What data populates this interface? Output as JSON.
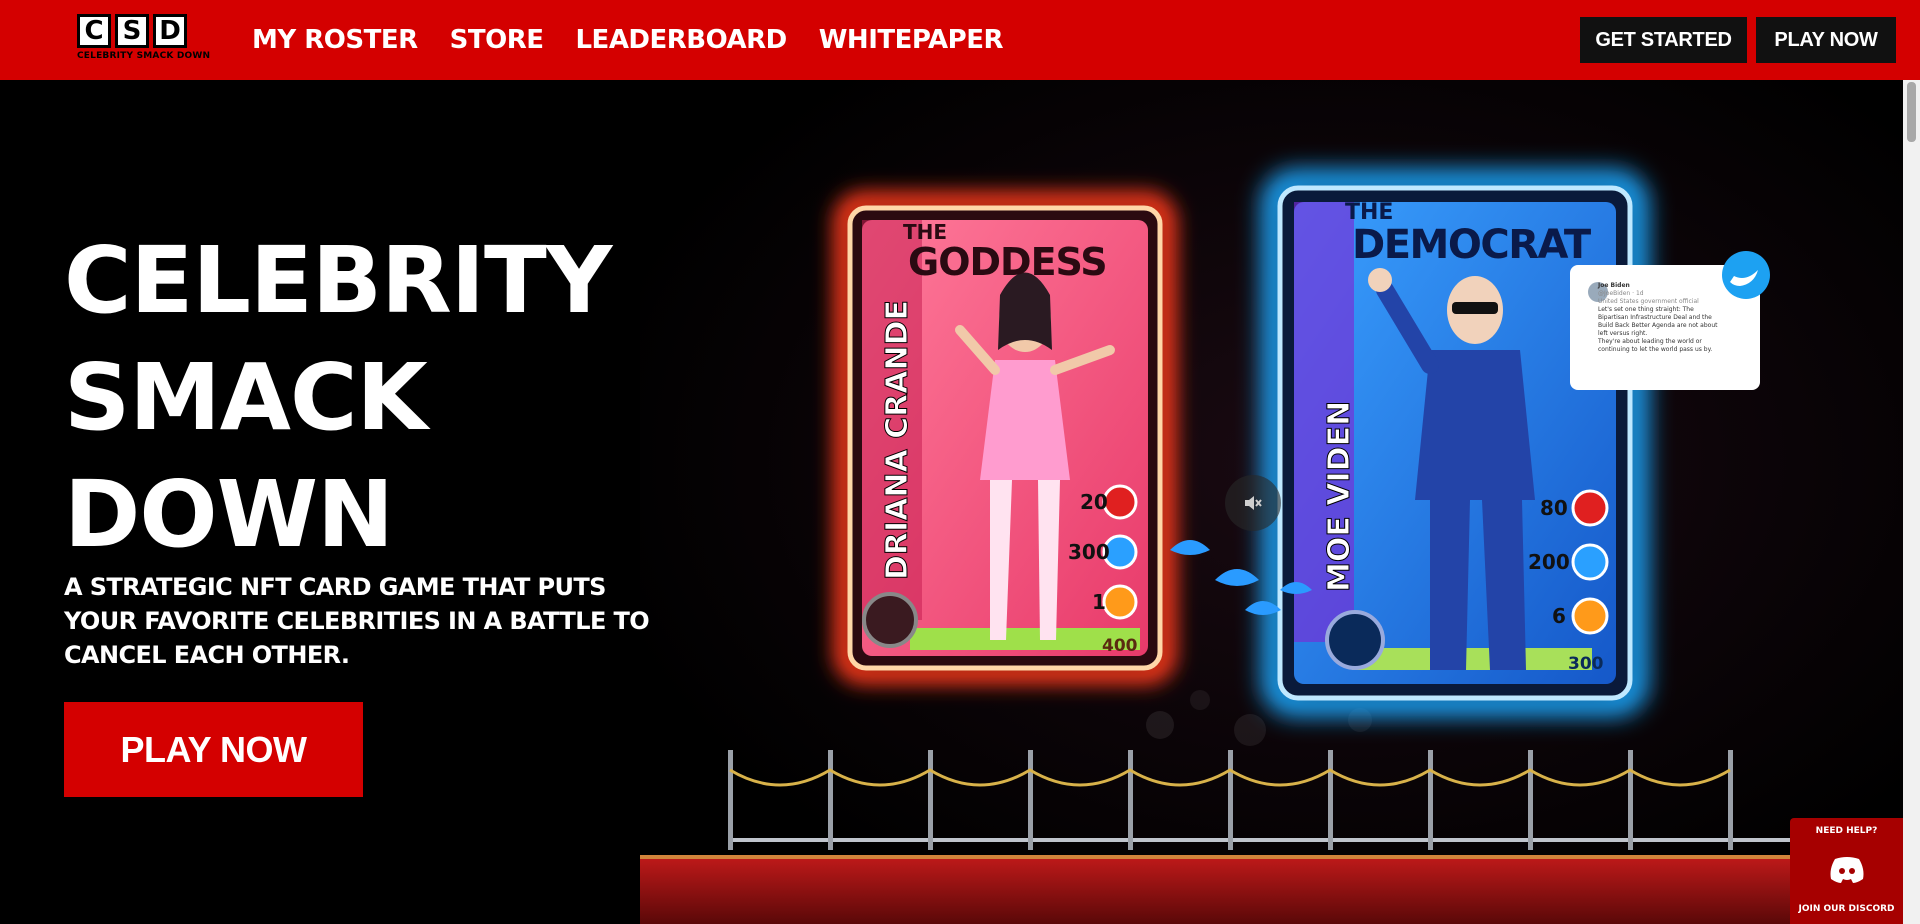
{
  "logo": {
    "letters": [
      "C",
      "S",
      "D"
    ],
    "caption": "CELEBRITY SMACK DOWN"
  },
  "nav": {
    "items": [
      "MY ROSTER",
      "STORE",
      "LEADERBOARD",
      "WHITEPAPER"
    ]
  },
  "header_buttons": {
    "get_started": "GET STARTED",
    "play_now": "PLAY NOW"
  },
  "hero": {
    "title_lines": [
      "CELEBRITY",
      "SMACK",
      "DOWN"
    ],
    "subtitle": "A STRATEGIC NFT CARD GAME THAT PUTS YOUR FAVORITE CELEBRITIES IN A BATTLE TO CANCEL EACH OTHER.",
    "cta": "PLAY NOW"
  },
  "cards": {
    "left": {
      "title_prefix": "THE",
      "title": "GODDESS",
      "name": "DRIANA CRANDE",
      "stats": [
        "20",
        "300",
        "1"
      ],
      "score": "400",
      "accent": "#ff3b1f"
    },
    "right": {
      "title_prefix": "THE",
      "title": "DEMOCRAT",
      "name": "MOE VIDEN",
      "stats": [
        "80",
        "200",
        "6"
      ],
      "score": "300",
      "accent": "#1fa8ff"
    }
  },
  "tweet": {
    "author": "Joe Biden",
    "handle": "@JoeBiden · 1d",
    "official": "United States government official",
    "line1": "Let's set one thing straight: The",
    "line2": "Bipartisan Infrastructure Deal and the",
    "line3": "Build Back Better Agenda are not about",
    "line4": "left versus right.",
    "line5": "They're about leading the world or",
    "line6": "continuing to let the world pass us by."
  },
  "icons": {
    "mute": "mute-icon",
    "twitter": "twitter-icon",
    "discord": "discord-icon"
  },
  "discord": {
    "help": "NEED HELP?",
    "join": "JOIN OUR DISCORD"
  },
  "colors": {
    "brand_red": "#d40000",
    "dark": "#111111",
    "twitter_blue": "#1da1f2"
  }
}
